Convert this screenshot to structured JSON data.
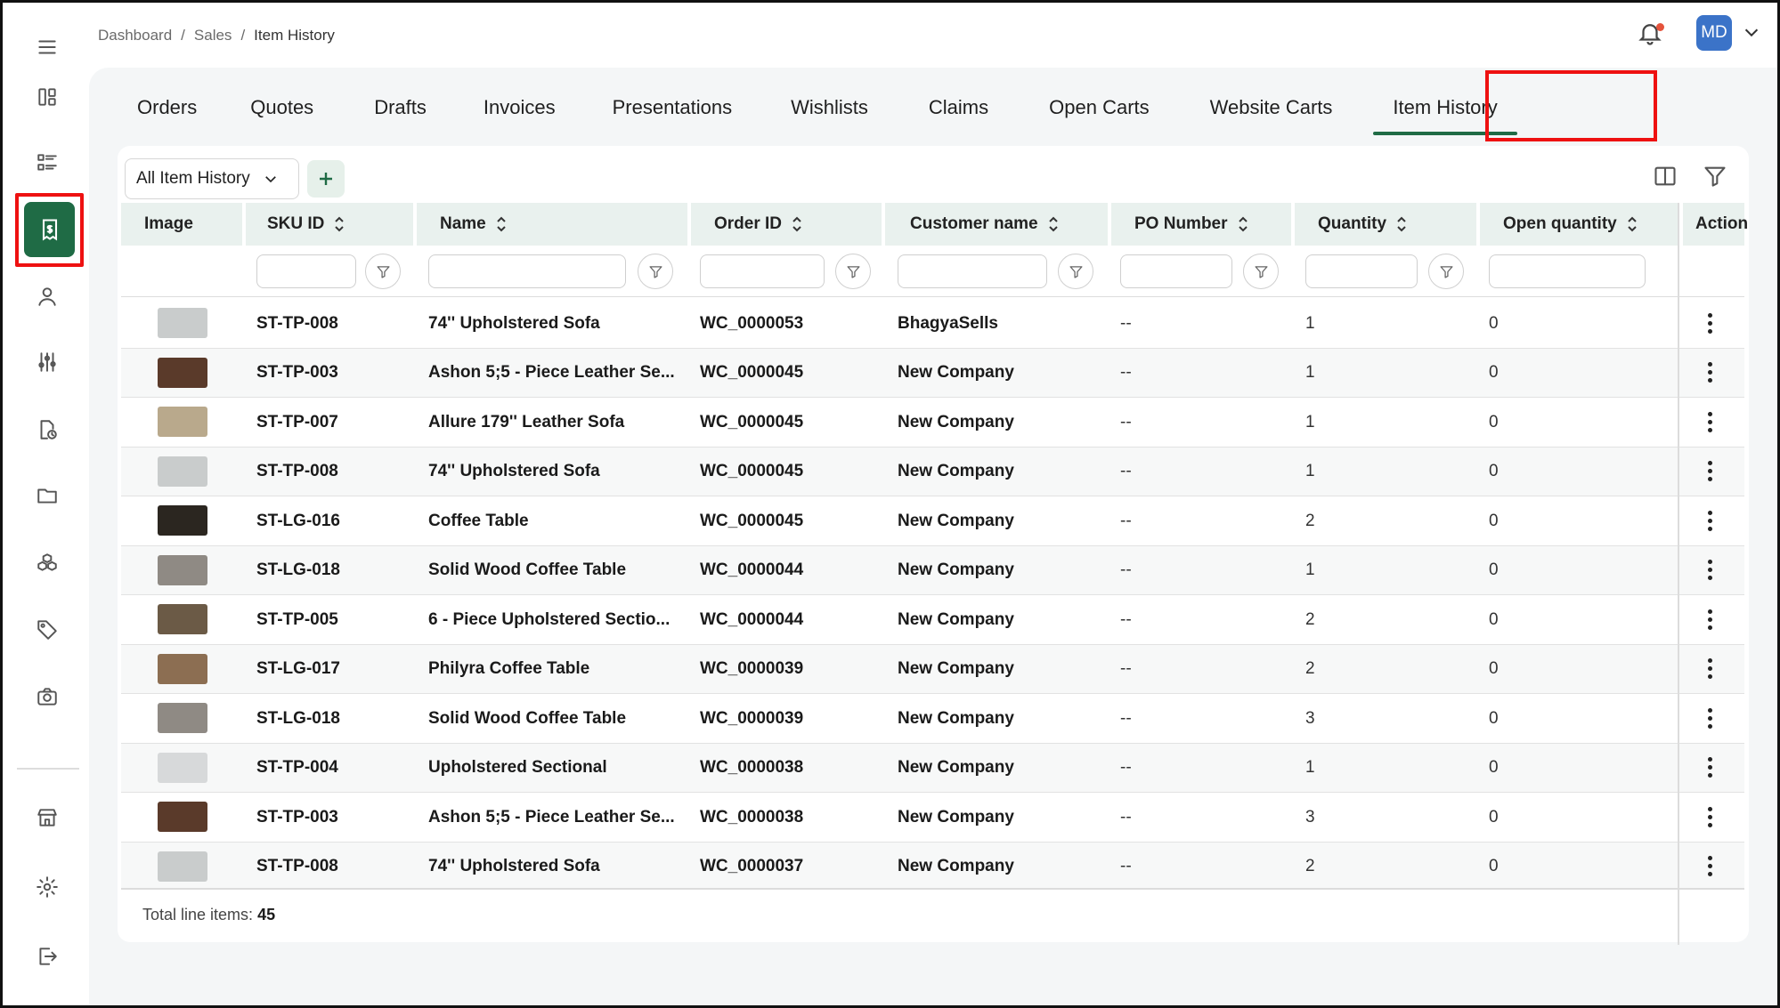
{
  "breadcrumb": {
    "items": [
      "Dashboard",
      "Sales",
      "Item History"
    ],
    "separator": "/"
  },
  "header": {
    "avatar_initials": "MD",
    "notification_icon": "bell-icon"
  },
  "sidebar": {
    "items": [
      {
        "name": "menu",
        "icon": "hamburger-icon"
      },
      {
        "name": "dashboard",
        "icon": "dashboard-icon"
      },
      {
        "name": "catalog",
        "icon": "list-icon"
      },
      {
        "name": "sales",
        "icon": "sales-receipt-icon",
        "active": true
      },
      {
        "name": "customers",
        "icon": "user-icon"
      },
      {
        "name": "settings-sliders",
        "icon": "sliders-icon"
      },
      {
        "name": "reports",
        "icon": "file-clock-icon"
      },
      {
        "name": "files",
        "icon": "folder-icon"
      },
      {
        "name": "products",
        "icon": "cubes-icon"
      },
      {
        "name": "pricing",
        "icon": "tag-icon"
      },
      {
        "name": "camera",
        "icon": "camera-icon"
      },
      {
        "name": "store",
        "icon": "store-icon"
      },
      {
        "name": "settings",
        "icon": "gear-icon"
      },
      {
        "name": "logout",
        "icon": "logout-icon"
      }
    ]
  },
  "tabs": [
    {
      "label": "Orders"
    },
    {
      "label": "Quotes"
    },
    {
      "label": "Drafts"
    },
    {
      "label": "Invoices"
    },
    {
      "label": "Presentations"
    },
    {
      "label": "Wishlists"
    },
    {
      "label": "Claims"
    },
    {
      "label": "Open Carts"
    },
    {
      "label": "Website Carts"
    },
    {
      "label": "Item History",
      "active": true
    }
  ],
  "toolbar": {
    "view_select": "All Item History"
  },
  "table": {
    "columns": [
      "Image",
      "SKU ID",
      "Name",
      "Order ID",
      "Customer name",
      "PO Number",
      "Quantity",
      "Open quantity",
      "Action"
    ],
    "rows": [
      {
        "sku": "ST-TP-008",
        "name": "74'' Upholstered Sofa",
        "order": "WC_0000053",
        "customer": "BhagyaSells",
        "po": "--",
        "qty": "1",
        "open": "0",
        "thumb": "#c9cccc"
      },
      {
        "sku": "ST-TP-003",
        "name": "Ashon 5;5 - Piece Leather Se...",
        "order": "WC_0000045",
        "customer": "New Company",
        "po": "--",
        "qty": "1",
        "open": "0",
        "thumb": "#5a3a2a"
      },
      {
        "sku": "ST-TP-007",
        "name": "Allure 179'' Leather Sofa",
        "order": "WC_0000045",
        "customer": "New Company",
        "po": "--",
        "qty": "1",
        "open": "0",
        "thumb": "#b9a98c"
      },
      {
        "sku": "ST-TP-008",
        "name": "74'' Upholstered Sofa",
        "order": "WC_0000045",
        "customer": "New Company",
        "po": "--",
        "qty": "1",
        "open": "0",
        "thumb": "#c9cccc"
      },
      {
        "sku": "ST-LG-016",
        "name": "Coffee Table",
        "order": "WC_0000045",
        "customer": "New Company",
        "po": "--",
        "qty": "2",
        "open": "0",
        "thumb": "#2b2620"
      },
      {
        "sku": "ST-LG-018",
        "name": "Solid Wood Coffee Table",
        "order": "WC_0000044",
        "customer": "New Company",
        "po": "--",
        "qty": "1",
        "open": "0",
        "thumb": "#8f8a84"
      },
      {
        "sku": "ST-TP-005",
        "name": "6 - Piece Upholstered Sectio...",
        "order": "WC_0000044",
        "customer": "New Company",
        "po": "--",
        "qty": "2",
        "open": "0",
        "thumb": "#6b5a46"
      },
      {
        "sku": "ST-LG-017",
        "name": "Philyra Coffee Table",
        "order": "WC_0000039",
        "customer": "New Company",
        "po": "--",
        "qty": "2",
        "open": "0",
        "thumb": "#8c6e52"
      },
      {
        "sku": "ST-LG-018",
        "name": "Solid Wood Coffee Table",
        "order": "WC_0000039",
        "customer": "New Company",
        "po": "--",
        "qty": "3",
        "open": "0",
        "thumb": "#8f8a84"
      },
      {
        "sku": "ST-TP-004",
        "name": "Upholstered Sectional",
        "order": "WC_0000038",
        "customer": "New Company",
        "po": "--",
        "qty": "1",
        "open": "0",
        "thumb": "#d7d9da"
      },
      {
        "sku": "ST-TP-003",
        "name": "Ashon 5;5 - Piece Leather Se...",
        "order": "WC_0000038",
        "customer": "New Company",
        "po": "--",
        "qty": "3",
        "open": "0",
        "thumb": "#5a3a2a"
      },
      {
        "sku": "ST-TP-008",
        "name": "74'' Upholstered Sofa",
        "order": "WC_0000037",
        "customer": "New Company",
        "po": "--",
        "qty": "2",
        "open": "0",
        "thumb": "#c9cccc"
      }
    ]
  },
  "footer": {
    "total_label": "Total line items:",
    "total_value": "45"
  },
  "colors": {
    "accent": "#1f6b45",
    "highlight": "#e11111",
    "avatar": "#3b73c8",
    "header_bg": "#e9f1ee"
  }
}
